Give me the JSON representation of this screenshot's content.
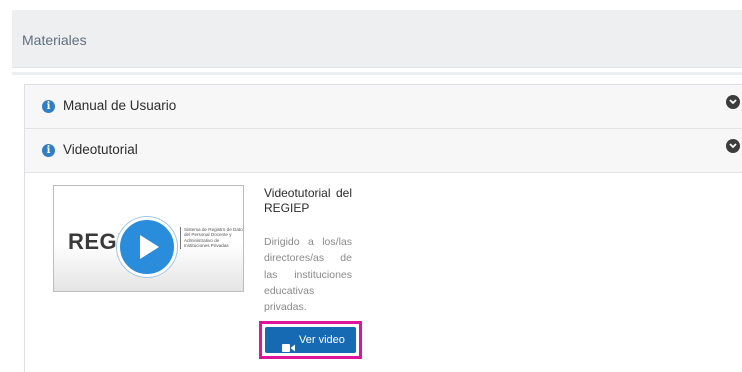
{
  "panel": {
    "title": "Materiales"
  },
  "accordion": {
    "items": [
      {
        "label": "Manual de Usuario"
      },
      {
        "label": "Videotutorial"
      }
    ]
  },
  "video_card": {
    "thumbnail_text": "REGIEP",
    "thumbnail_subtitle": "Sistema de Registro de Datos del Personal Docente y Administrativo de Instituciones Privadas",
    "title": "Videotutorial del REGIEP",
    "description": "Dirigido a los/las directores/as de las instituciones educativas privadas.",
    "button_label": "Ver video",
    "button_icon": "video-camera-icon"
  },
  "colors": {
    "accent": "#1669b3",
    "info_icon": "#2f7fc2",
    "highlight": "#e0149b",
    "play_button": "#2a8ddc"
  }
}
